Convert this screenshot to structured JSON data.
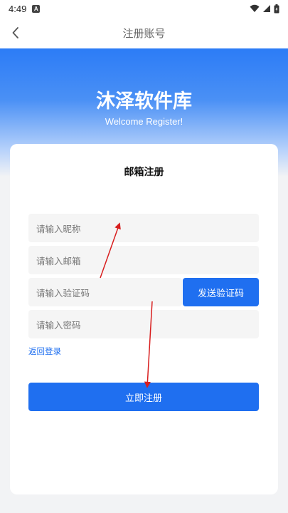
{
  "status_bar": {
    "time": "4:49",
    "notification_badge": "A",
    "icons": [
      "wifi-icon",
      "signal-icon",
      "battery-icon"
    ]
  },
  "navbar": {
    "title": "注册账号",
    "back_icon": "chevron-left-icon"
  },
  "hero": {
    "app_name": "沐泽软件库",
    "subtitle": "Welcome Register!"
  },
  "form": {
    "title": "邮箱注册",
    "nickname_placeholder": "请输入昵称",
    "email_placeholder": "请输入邮箱",
    "code_placeholder": "请输入验证码",
    "send_code_label": "发送验证码",
    "password_placeholder": "请输入密码",
    "back_to_login": "返回登录",
    "submit_label": "立即注册"
  },
  "colors": {
    "primary": "#1f6ff0",
    "annotation": "#d81e1e"
  }
}
